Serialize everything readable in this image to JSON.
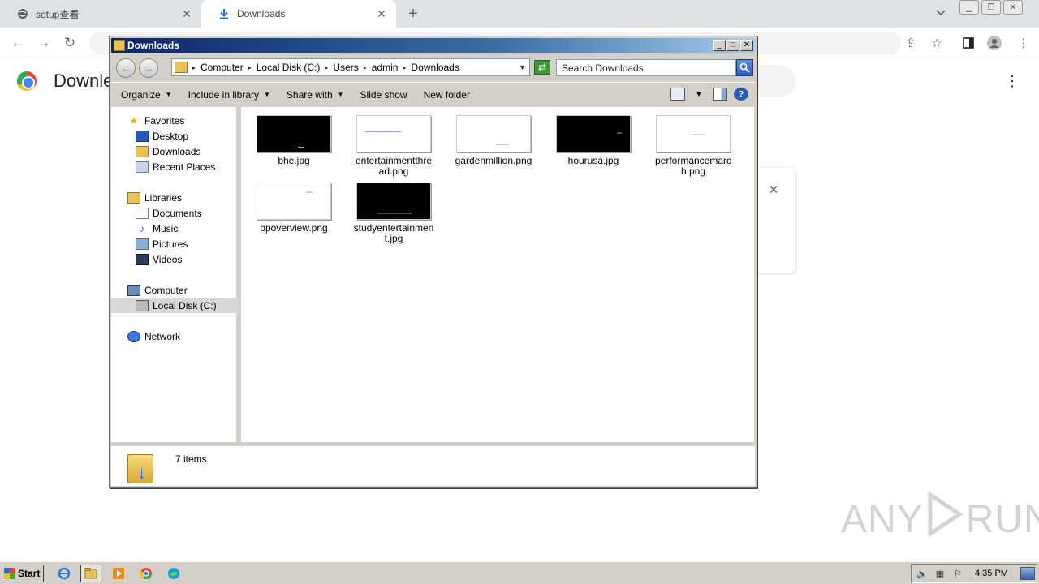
{
  "browser": {
    "tabs": [
      {
        "title": "setup查看",
        "icon": "globe-icon",
        "active": false
      },
      {
        "title": "Downloads",
        "icon": "download-icon",
        "active": true
      }
    ],
    "page_title": "Downle"
  },
  "explorer": {
    "title": "Downloads",
    "breadcrumb": [
      "Computer",
      "Local Disk (C:)",
      "Users",
      "admin",
      "Downloads"
    ],
    "search_placeholder": "Search Downloads",
    "commands": [
      {
        "label": "Organize",
        "has_menu": true
      },
      {
        "label": "Include in library",
        "has_menu": true
      },
      {
        "label": "Share with",
        "has_menu": true
      },
      {
        "label": "Slide show",
        "has_menu": false
      },
      {
        "label": "New folder",
        "has_menu": false
      }
    ],
    "nav": {
      "favorites": {
        "label": "Favorites",
        "items": [
          "Desktop",
          "Downloads",
          "Recent Places"
        ]
      },
      "libraries": {
        "label": "Libraries",
        "items": [
          "Documents",
          "Music",
          "Pictures",
          "Videos"
        ]
      },
      "computer": {
        "label": "Computer",
        "items": [
          "Local Disk (C:)"
        ]
      },
      "network": {
        "label": "Network"
      }
    },
    "files": [
      {
        "name": "bhe.jpg",
        "thumb": "dark"
      },
      {
        "name": "entertainmentthread.png",
        "thumb": "light"
      },
      {
        "name": "gardenmillion.png",
        "thumb": "light"
      },
      {
        "name": "hourusa.jpg",
        "thumb": "dark"
      },
      {
        "name": "performancemarch.png",
        "thumb": "light"
      },
      {
        "name": "ppoverview.png",
        "thumb": "light"
      },
      {
        "name": "studyentertainment.jpg",
        "thumb": "dark"
      }
    ],
    "status": "7 items"
  },
  "taskbar": {
    "start_label": "Start",
    "clock": "4:35 PM"
  },
  "watermark": {
    "left": "ANY",
    "right": "RUN"
  }
}
